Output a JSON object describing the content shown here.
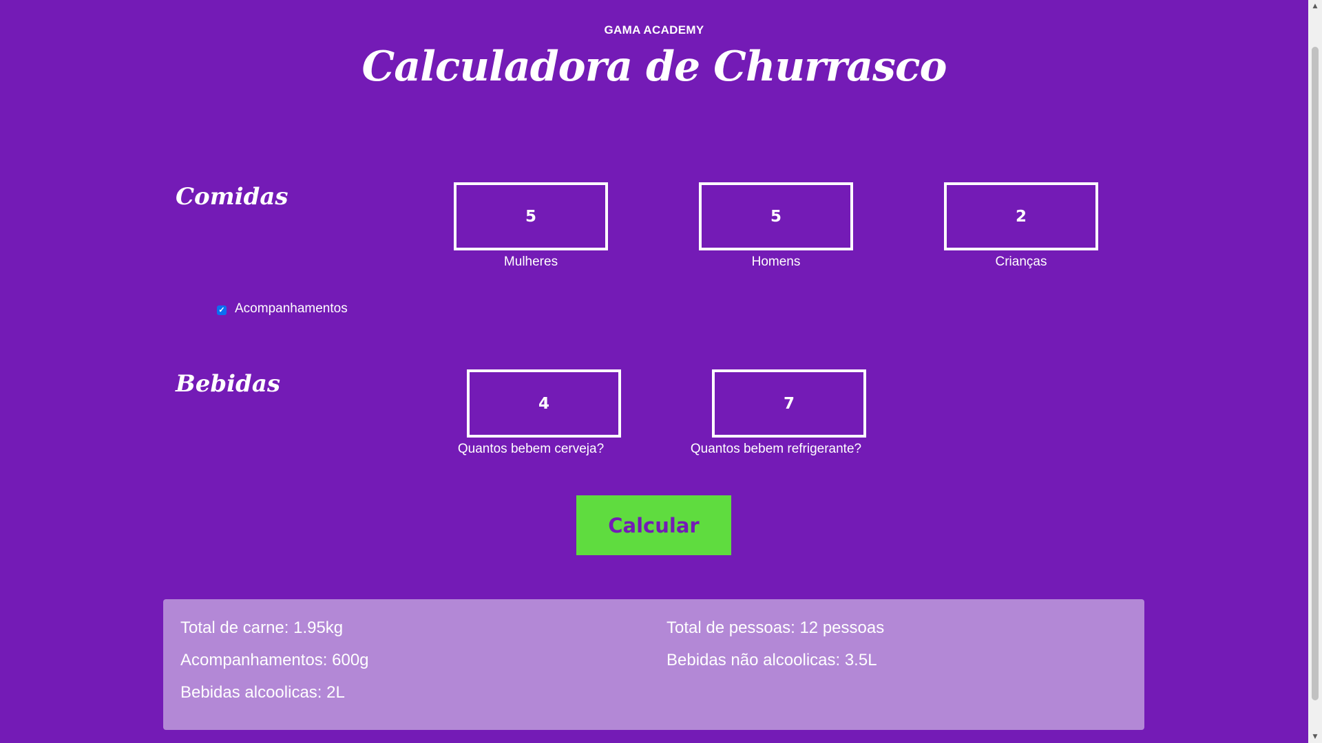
{
  "header": {
    "brand": "GAMA ACADEMY",
    "title": "Calculadora de Churrasco"
  },
  "comidas": {
    "section_title": "Comidas",
    "fields": [
      {
        "value": "5",
        "label": "Mulheres"
      },
      {
        "value": "5",
        "label": "Homens"
      },
      {
        "value": "2",
        "label": "Crianças"
      }
    ],
    "checkbox": {
      "label": "Acompanhamentos",
      "checked": true
    }
  },
  "bebidas": {
    "section_title": "Bebidas",
    "fields": [
      {
        "value": "4",
        "label": "Quantos bebem cerveja?"
      },
      {
        "value": "7",
        "label": "Quantos bebem refrigerante?"
      }
    ]
  },
  "button": {
    "label": "Calcular"
  },
  "results": {
    "total_carne": "Total de carne: 1.95kg",
    "acompanhamentos": "Acompanhamentos: 600g",
    "bebidas_alcoolicas": "Bebidas alcoolicas: 2L",
    "total_pessoas": "Total de pessoas: 12 pessoas",
    "bebidas_nao_alcoolicas": "Bebidas não alcoolicas: 3.5L"
  },
  "colors": {
    "background": "#741bb6",
    "button": "#5fdc3f",
    "results_panel": "#b388d6",
    "checkbox": "#0b6ff2"
  }
}
